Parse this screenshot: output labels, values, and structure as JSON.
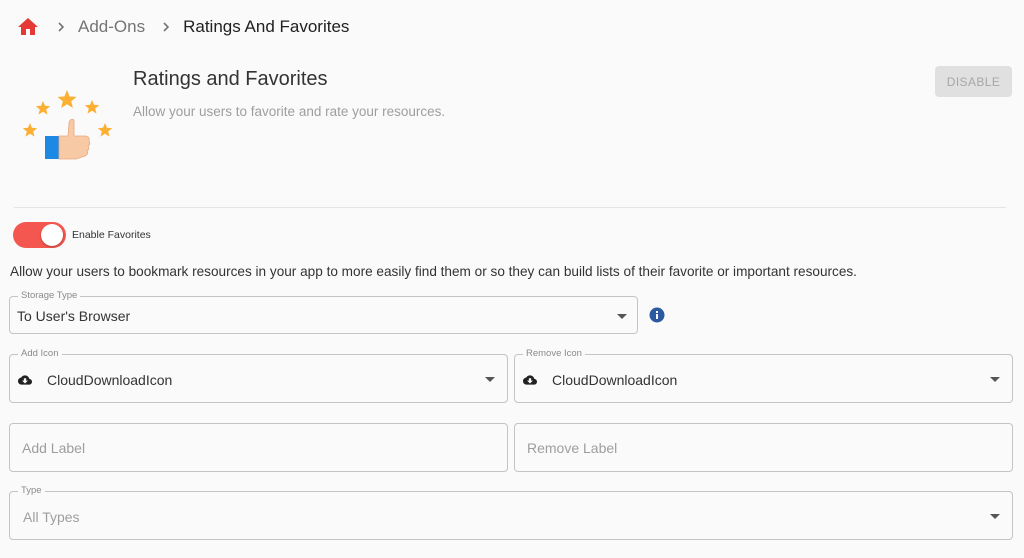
{
  "breadcrumb": {
    "home_icon": "home-icon",
    "items": [
      {
        "label": "Add-Ons"
      },
      {
        "label": "Ratings And Favorites"
      }
    ]
  },
  "addon": {
    "title": "Ratings and Favorites",
    "description": "Allow your users to favorite and rate your resources.",
    "image_icon": "thumbs-up-stars-illustration",
    "disable_label": "DISABLE"
  },
  "favorites": {
    "enabled": true,
    "toggle_label": "Enable Favorites",
    "description": "Allow your users to bookmark resources in your app to more easily find them or so they can build lists of their favorite or important resources."
  },
  "storage_type": {
    "label": "Storage Type",
    "value": "To User's Browser",
    "info_icon": "info-icon"
  },
  "add_icon": {
    "label": "Add Icon",
    "value": "CloudDownloadIcon",
    "icon": "cloud-download-icon"
  },
  "remove_icon": {
    "label": "Remove Icon",
    "value": "CloudDownloadIcon",
    "icon": "cloud-download-icon"
  },
  "add_label": {
    "placeholder": "Add Label"
  },
  "remove_label": {
    "placeholder": "Remove Label"
  },
  "type_field": {
    "label": "Type",
    "placeholder": "All Types"
  },
  "colors": {
    "accent": "#f4574f",
    "home": "#e53935",
    "star": "#fbb034",
    "info": "#2c5aa0"
  }
}
